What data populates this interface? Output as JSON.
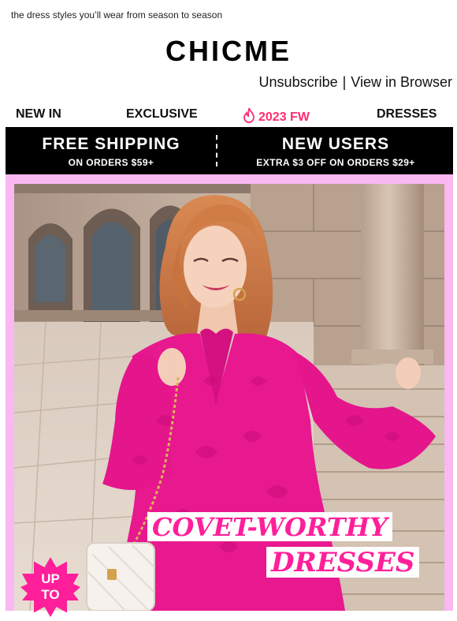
{
  "preheader": "the dress styles you’ll wear from season to season",
  "brand": "CHICME",
  "header_links": {
    "unsubscribe": "Unsubscribe",
    "separator": "|",
    "view_in_browser": "View in Browser"
  },
  "nav": [
    {
      "label": "NEW IN"
    },
    {
      "label": "EXCLUSIVE"
    },
    {
      "label": "2023 FW",
      "icon": "flame-icon"
    },
    {
      "label": "DRESSES"
    }
  ],
  "promo": {
    "left": {
      "title": "FREE SHIPPING",
      "subtitle": "ON ORDERS $59+"
    },
    "right": {
      "title": "NEW USERS",
      "subtitle": "EXTRA $3 OFF ON ORDERS $29+"
    }
  },
  "hero": {
    "headline_line1": "COVET-WORTHY",
    "headline_line2": "DRESSES",
    "badge_line1": "UP",
    "badge_line2": "TO"
  },
  "colors": {
    "accent_pink": "#ff1f9a",
    "frame_pink": "#f9b8f2",
    "hot_nav": "#ff2d6f",
    "promo_bg": "#000000",
    "dress": "#e8188f"
  }
}
